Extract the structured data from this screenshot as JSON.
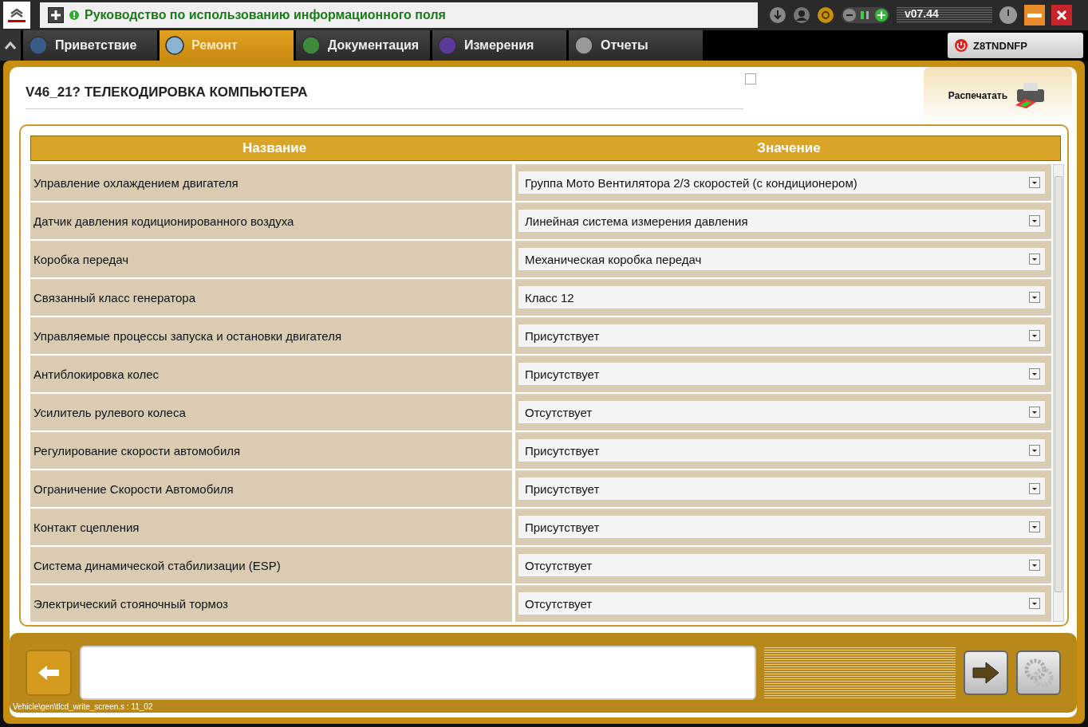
{
  "header": {
    "title": "Руководство по использованию информационного поля",
    "version": "v07.44"
  },
  "tabs": [
    {
      "label": "Приветствие",
      "selected": false
    },
    {
      "label": "Ремонт",
      "selected": true
    },
    {
      "label": "Документация",
      "selected": false
    },
    {
      "label": "Измерения",
      "selected": false
    },
    {
      "label": "Отчеты",
      "selected": false
    }
  ],
  "vin": "Z8TNDNFP",
  "page": {
    "title": "V46_21?  ТЕЛЕКОДИРОВКА КОМПЬЮТЕРА",
    "print_button": "Распечатать"
  },
  "table": {
    "columns": [
      "Название",
      "Значение"
    ],
    "rows": [
      {
        "name": "Управление охлаждением двигателя",
        "value": "Группа Мото Вентилятора 2/3 скоростей (с кондиционером)"
      },
      {
        "name": "Датчик давления кодиционированного воздуха",
        "value": "Линейная система измерения давления"
      },
      {
        "name": "Коробка передач",
        "value": "Механическая коробка передач"
      },
      {
        "name": "Связанный класс генератора",
        "value": "Класс 12"
      },
      {
        "name": "Управляемые процессы запуска и остановки двигателя",
        "value": "Присутствует"
      },
      {
        "name": "Антиблокировка колес",
        "value": "Присутствует"
      },
      {
        "name": "Усилитель рулевого колеса",
        "value": "Отсутствует"
      },
      {
        "name": "Регулирование скорости автомобиля",
        "value": "Присутствует"
      },
      {
        "name": "Ограничение Скорости Автомобиля",
        "value": "Присутствует"
      },
      {
        "name": "Контакт сцепления",
        "value": "Присутствует"
      },
      {
        "name": "Система динамической стабилизации (ESP)",
        "value": "Отсутствует"
      },
      {
        "name": "Электрический стояночный тормоз",
        "value": "Отсутствует"
      }
    ]
  },
  "status_path": "Vehicle\\gen\\tlcd_write_screen.s : 11_02"
}
